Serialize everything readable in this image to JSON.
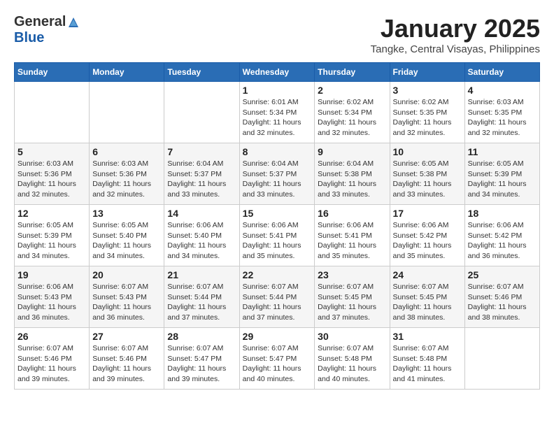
{
  "header": {
    "logo_general": "General",
    "logo_blue": "Blue",
    "month_title": "January 2025",
    "location": "Tangke, Central Visayas, Philippines"
  },
  "days_of_week": [
    "Sunday",
    "Monday",
    "Tuesday",
    "Wednesday",
    "Thursday",
    "Friday",
    "Saturday"
  ],
  "weeks": [
    [
      {
        "day": "",
        "info": ""
      },
      {
        "day": "",
        "info": ""
      },
      {
        "day": "",
        "info": ""
      },
      {
        "day": "1",
        "info": "Sunrise: 6:01 AM\nSunset: 5:34 PM\nDaylight: 11 hours and 32 minutes."
      },
      {
        "day": "2",
        "info": "Sunrise: 6:02 AM\nSunset: 5:34 PM\nDaylight: 11 hours and 32 minutes."
      },
      {
        "day": "3",
        "info": "Sunrise: 6:02 AM\nSunset: 5:35 PM\nDaylight: 11 hours and 32 minutes."
      },
      {
        "day": "4",
        "info": "Sunrise: 6:03 AM\nSunset: 5:35 PM\nDaylight: 11 hours and 32 minutes."
      }
    ],
    [
      {
        "day": "5",
        "info": "Sunrise: 6:03 AM\nSunset: 5:36 PM\nDaylight: 11 hours and 32 minutes."
      },
      {
        "day": "6",
        "info": "Sunrise: 6:03 AM\nSunset: 5:36 PM\nDaylight: 11 hours and 32 minutes."
      },
      {
        "day": "7",
        "info": "Sunrise: 6:04 AM\nSunset: 5:37 PM\nDaylight: 11 hours and 33 minutes."
      },
      {
        "day": "8",
        "info": "Sunrise: 6:04 AM\nSunset: 5:37 PM\nDaylight: 11 hours and 33 minutes."
      },
      {
        "day": "9",
        "info": "Sunrise: 6:04 AM\nSunset: 5:38 PM\nDaylight: 11 hours and 33 minutes."
      },
      {
        "day": "10",
        "info": "Sunrise: 6:05 AM\nSunset: 5:38 PM\nDaylight: 11 hours and 33 minutes."
      },
      {
        "day": "11",
        "info": "Sunrise: 6:05 AM\nSunset: 5:39 PM\nDaylight: 11 hours and 34 minutes."
      }
    ],
    [
      {
        "day": "12",
        "info": "Sunrise: 6:05 AM\nSunset: 5:39 PM\nDaylight: 11 hours and 34 minutes."
      },
      {
        "day": "13",
        "info": "Sunrise: 6:05 AM\nSunset: 5:40 PM\nDaylight: 11 hours and 34 minutes."
      },
      {
        "day": "14",
        "info": "Sunrise: 6:06 AM\nSunset: 5:40 PM\nDaylight: 11 hours and 34 minutes."
      },
      {
        "day": "15",
        "info": "Sunrise: 6:06 AM\nSunset: 5:41 PM\nDaylight: 11 hours and 35 minutes."
      },
      {
        "day": "16",
        "info": "Sunrise: 6:06 AM\nSunset: 5:41 PM\nDaylight: 11 hours and 35 minutes."
      },
      {
        "day": "17",
        "info": "Sunrise: 6:06 AM\nSunset: 5:42 PM\nDaylight: 11 hours and 35 minutes."
      },
      {
        "day": "18",
        "info": "Sunrise: 6:06 AM\nSunset: 5:42 PM\nDaylight: 11 hours and 36 minutes."
      }
    ],
    [
      {
        "day": "19",
        "info": "Sunrise: 6:06 AM\nSunset: 5:43 PM\nDaylight: 11 hours and 36 minutes."
      },
      {
        "day": "20",
        "info": "Sunrise: 6:07 AM\nSunset: 5:43 PM\nDaylight: 11 hours and 36 minutes."
      },
      {
        "day": "21",
        "info": "Sunrise: 6:07 AM\nSunset: 5:44 PM\nDaylight: 11 hours and 37 minutes."
      },
      {
        "day": "22",
        "info": "Sunrise: 6:07 AM\nSunset: 5:44 PM\nDaylight: 11 hours and 37 minutes."
      },
      {
        "day": "23",
        "info": "Sunrise: 6:07 AM\nSunset: 5:45 PM\nDaylight: 11 hours and 37 minutes."
      },
      {
        "day": "24",
        "info": "Sunrise: 6:07 AM\nSunset: 5:45 PM\nDaylight: 11 hours and 38 minutes."
      },
      {
        "day": "25",
        "info": "Sunrise: 6:07 AM\nSunset: 5:46 PM\nDaylight: 11 hours and 38 minutes."
      }
    ],
    [
      {
        "day": "26",
        "info": "Sunrise: 6:07 AM\nSunset: 5:46 PM\nDaylight: 11 hours and 39 minutes."
      },
      {
        "day": "27",
        "info": "Sunrise: 6:07 AM\nSunset: 5:46 PM\nDaylight: 11 hours and 39 minutes."
      },
      {
        "day": "28",
        "info": "Sunrise: 6:07 AM\nSunset: 5:47 PM\nDaylight: 11 hours and 39 minutes."
      },
      {
        "day": "29",
        "info": "Sunrise: 6:07 AM\nSunset: 5:47 PM\nDaylight: 11 hours and 40 minutes."
      },
      {
        "day": "30",
        "info": "Sunrise: 6:07 AM\nSunset: 5:48 PM\nDaylight: 11 hours and 40 minutes."
      },
      {
        "day": "31",
        "info": "Sunrise: 6:07 AM\nSunset: 5:48 PM\nDaylight: 11 hours and 41 minutes."
      },
      {
        "day": "",
        "info": ""
      }
    ]
  ]
}
